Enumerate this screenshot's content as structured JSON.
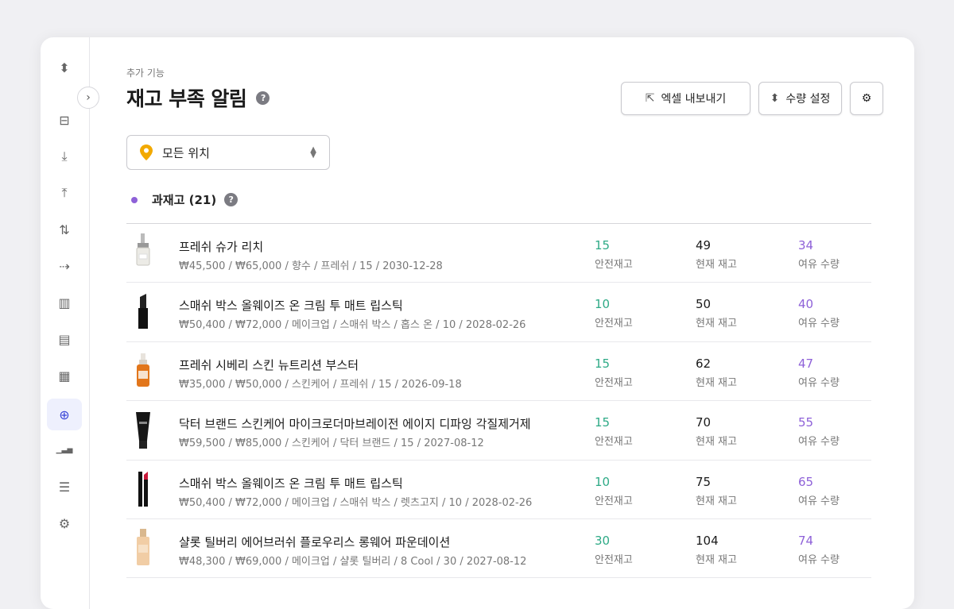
{
  "sidebar": {
    "items": [
      {
        "icon": "sort-icon",
        "glyph": "⬍",
        "active": false
      },
      {
        "icon": "package-icon",
        "glyph": "⊟",
        "active": false
      },
      {
        "icon": "download-icon",
        "glyph": "⤓",
        "active": false
      },
      {
        "icon": "upload-icon",
        "glyph": "⤒",
        "active": false
      },
      {
        "icon": "transfer-icon",
        "glyph": "⇅",
        "active": false
      },
      {
        "icon": "arrow-right-icon",
        "glyph": "⇢",
        "active": false
      },
      {
        "icon": "stock-chart-icon",
        "glyph": "▥",
        "active": false
      },
      {
        "icon": "document-icon",
        "glyph": "▤",
        "active": false
      },
      {
        "icon": "barcode-icon",
        "glyph": "▦",
        "active": false
      },
      {
        "icon": "add-circle-icon",
        "glyph": "⊕",
        "active": true
      },
      {
        "icon": "bar-chart-icon",
        "glyph": "▁▃▅",
        "active": false
      },
      {
        "icon": "database-icon",
        "glyph": "☰",
        "active": false
      },
      {
        "icon": "settings-icon",
        "glyph": "⚙",
        "active": false
      }
    ],
    "collapse_glyph": "›"
  },
  "header": {
    "breadcrumb": "추가 기능",
    "title": "재고 부족 알림",
    "help": "?"
  },
  "toolbar": {
    "export_label": "엑셀 내보내기",
    "export_icon": "⇱",
    "qty_label": "수량 설정",
    "qty_icon": "⬍",
    "gear_icon": "⚙"
  },
  "location": {
    "value": "모든 위치",
    "pin_color": "#f2a900"
  },
  "section": {
    "label": "과재고 (21)",
    "dot_color": "#8e61d8",
    "help": "?"
  },
  "colors": {
    "safety": "#2eaa86",
    "current": "#1a1a1a",
    "spare": "#8e61d8"
  },
  "products": [
    {
      "name": "프레쉬 슈가 리치",
      "meta": "₩45,500 / ₩65,000 / 향수 / 프레쉬 / 15 / 2030-12-28",
      "safety": "15",
      "safety_label": "안전재고",
      "current": "49",
      "current_label": "현재 재고",
      "spare": "34",
      "spare_label": "여유 수량",
      "thumb": "perfume"
    },
    {
      "name": "스매쉬 박스 올웨이즈 온 크림 투 매트 립스틱",
      "meta": "₩50,400 / ₩72,000 / 메이크업 / 스매쉬 박스 / 홉스 온 / 10 / 2028-02-26",
      "safety": "10",
      "safety_label": "안전재고",
      "current": "50",
      "current_label": "현재 재고",
      "spare": "40",
      "spare_label": "여유 수량",
      "thumb": "lipstick-black"
    },
    {
      "name": "프레쉬 시베리 스킨 뉴트리션 부스터",
      "meta": "₩35,000 / ₩50,000 / 스킨케어 / 프레쉬 / 15 / 2026-09-18",
      "safety": "15",
      "safety_label": "안전재고",
      "current": "62",
      "current_label": "현재 재고",
      "spare": "47",
      "spare_label": "여유 수량",
      "thumb": "serum"
    },
    {
      "name": "닥터 브랜드 스킨케어 마이크로더마브레이전 에이지 디파잉 각질제거제",
      "meta": "₩59,500 / ₩85,000 / 스킨케어 / 닥터 브랜드 / 15 / 2027-08-12",
      "safety": "15",
      "safety_label": "안전재고",
      "current": "70",
      "current_label": "현재 재고",
      "spare": "55",
      "spare_label": "여유 수량",
      "thumb": "tube"
    },
    {
      "name": "스매쉬 박스 올웨이즈 온 크림 투 매트 립스틱",
      "meta": "₩50,400 / ₩72,000 / 메이크업 / 스매쉬 박스 / 렛츠고지 / 10 / 2028-02-26",
      "safety": "10",
      "safety_label": "안전재고",
      "current": "75",
      "current_label": "현재 재고",
      "spare": "65",
      "spare_label": "여유 수량",
      "thumb": "lipstick-red"
    },
    {
      "name": "샬롯 틸버리 에어브러쉬 플로우리스 롱웨어 파운데이션",
      "meta": "₩48,300 / ₩69,000 / 메이크업 / 샬롯 틸버리 / 8 Cool / 30 / 2027-08-12",
      "safety": "30",
      "safety_label": "안전재고",
      "current": "104",
      "current_label": "현재 재고",
      "spare": "74",
      "spare_label": "여유 수량",
      "thumb": "foundation"
    }
  ]
}
